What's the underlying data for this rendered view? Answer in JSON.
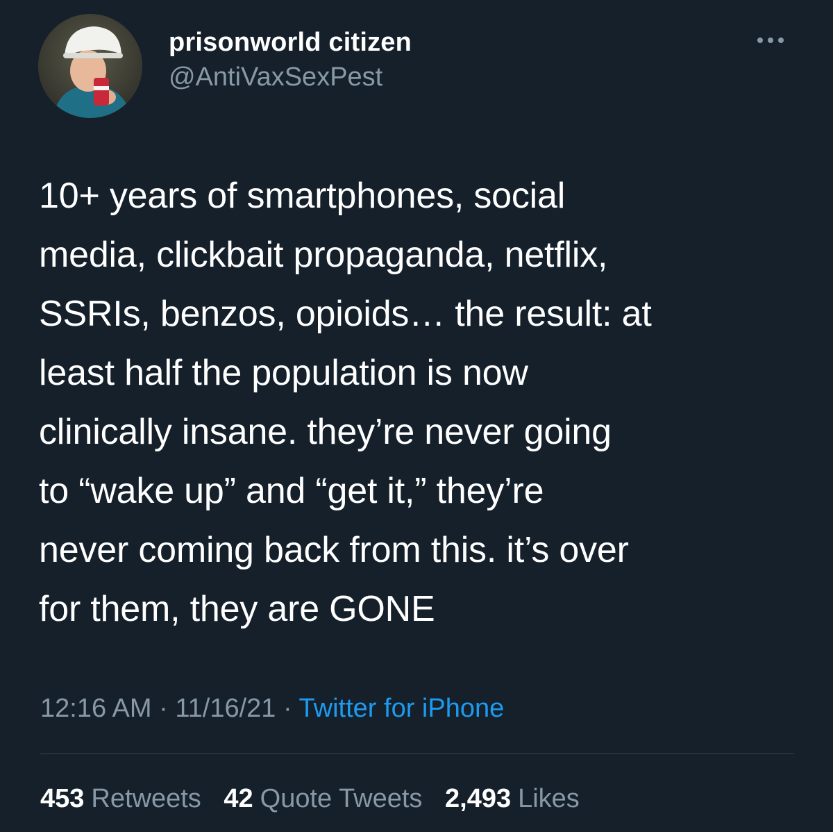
{
  "tweet": {
    "author": {
      "display_name": "prisonworld citizen",
      "handle": "@AntiVaxSexPest"
    },
    "text": "10+ years of smartphones, social\nmedia, clickbait propaganda, netflix,\nSSRIs, benzos, opioids… the result: at\nleast half the population is now\nclinically insane. they’re never going\nto “wake up” and “get it,” they’re\nnever coming back from this. it’s over\nfor them, they are GONE",
    "time": "12:16 AM",
    "separator": "·",
    "date": "11/16/21",
    "source": "Twitter for iPhone",
    "stats": {
      "retweets_count": "453",
      "retweets_label": "Retweets",
      "quotes_count": "42",
      "quotes_label": "Quote Tweets",
      "likes_count": "2,493",
      "likes_label": "Likes"
    }
  },
  "colors": {
    "background": "#15202b",
    "primary_text": "#ffffff",
    "secondary_text": "#8899a6",
    "link": "#1d9bf0",
    "divider": "#38444d"
  },
  "icons": {
    "more": "more-horizontal-icon"
  }
}
